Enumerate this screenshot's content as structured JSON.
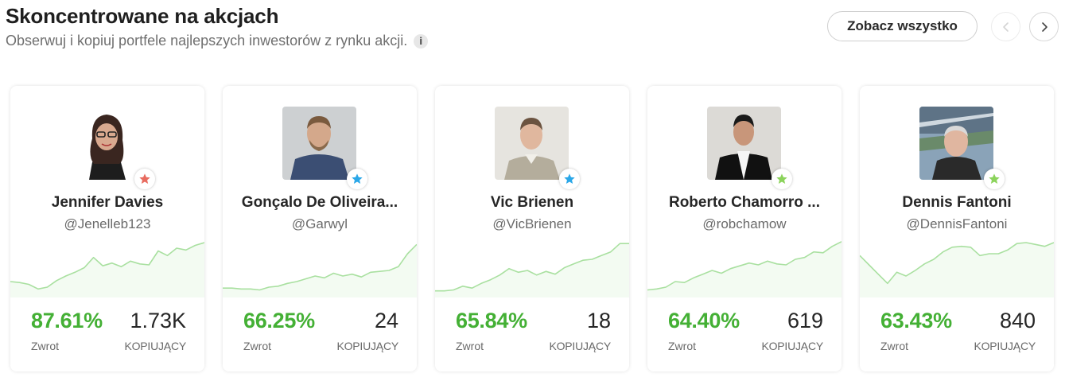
{
  "header": {
    "title": "Skoncentrowane na akcjach",
    "subtitle": "Obserwuj i kopiuj portfele najlepszych inwestorów z rynku akcji.",
    "info_icon": "info-icon",
    "see_all_label": "Zobacz wszystko",
    "prev_icon": "chevron-left-icon",
    "next_icon": "chevron-right-icon"
  },
  "colors": {
    "accent_green": "#44b035",
    "spark_line": "#a9e0a0",
    "star_red": "#e86b5f",
    "star_blue": "#2aa7e8",
    "star_green": "#8bd35b"
  },
  "cards": [
    {
      "name": "Jennifer Davies",
      "handle": "@Jenelleb123",
      "return_value": "87.61%",
      "return_label": "Zwrot",
      "copiers_value": "1.73K",
      "copiers_label": "KOPIUJĄCY",
      "badge_color": "#e86b5f",
      "spark": [
        12,
        11,
        9,
        4,
        6,
        13,
        18,
        22,
        27,
        38,
        29,
        32,
        28,
        34,
        31,
        30,
        45,
        40,
        48,
        46,
        51,
        54
      ]
    },
    {
      "name": "Gonçalo De Oliveira...",
      "handle": "@Garwyl",
      "return_value": "66.25%",
      "return_label": "Zwrot",
      "copiers_value": "24",
      "copiers_label": "KOPIUJĄCY",
      "badge_color": "#2aa7e8",
      "spark": [
        5,
        5,
        4,
        4,
        3,
        6,
        7,
        10,
        12,
        15,
        18,
        16,
        21,
        18,
        20,
        17,
        22,
        23,
        24,
        28,
        42,
        52
      ]
    },
    {
      "name": "Vic Brienen",
      "handle": "@VicBrienen",
      "return_value": "65.84%",
      "return_label": "Zwrot",
      "copiers_value": "18",
      "copiers_label": "KOPIUJĄCY",
      "badge_color": "#2aa7e8",
      "spark": [
        2,
        2,
        3,
        7,
        5,
        10,
        14,
        19,
        26,
        22,
        24,
        19,
        23,
        20,
        27,
        31,
        35,
        36,
        40,
        44,
        53,
        53
      ]
    },
    {
      "name": "Roberto Chamorro ...",
      "handle": "@robchamow",
      "return_value": "64.40%",
      "return_label": "Zwrot",
      "copiers_value": "619",
      "copiers_label": "KOPIUJĄCY",
      "badge_color": "#8bd35b",
      "spark": [
        3,
        4,
        6,
        12,
        11,
        16,
        20,
        24,
        21,
        26,
        29,
        32,
        30,
        34,
        31,
        30,
        36,
        38,
        44,
        43,
        50,
        55
      ]
    },
    {
      "name": "Dennis Fantoni",
      "handle": "@DennisFantoni",
      "return_value": "63.43%",
      "return_label": "Zwrot",
      "copiers_value": "840",
      "copiers_label": "KOPIUJĄCY",
      "badge_color": "#8bd35b",
      "spark": [
        40,
        30,
        20,
        10,
        22,
        18,
        24,
        31,
        36,
        44,
        49,
        50,
        49,
        40,
        42,
        42,
        46,
        53,
        54,
        52,
        50,
        54
      ]
    }
  ]
}
